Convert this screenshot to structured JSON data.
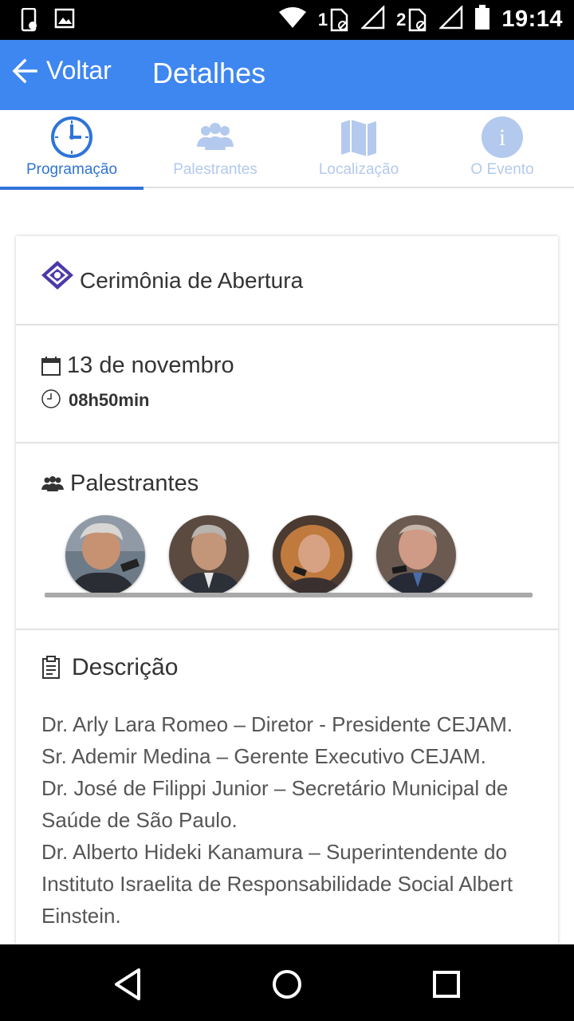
{
  "status_bar": {
    "time": "19:14",
    "sim1_label": "1",
    "sim2_label": "2",
    "icons": [
      "phone-settings-icon",
      "image-icon",
      "wifi-icon",
      "sim1-data-icon",
      "signal-icon",
      "sim2-data-icon",
      "signal-icon",
      "battery-icon"
    ]
  },
  "app_bar": {
    "back_label": "Voltar",
    "title": "Detalhes"
  },
  "tabs": [
    {
      "label": "Programação",
      "icon": "clock-icon",
      "active": true
    },
    {
      "label": "Palestrantes",
      "icon": "people-icon",
      "active": false
    },
    {
      "label": "Localização",
      "icon": "map-icon",
      "active": false
    },
    {
      "label": "O Evento",
      "icon": "info-icon",
      "active": false
    }
  ],
  "event": {
    "title": "Cerimônia de Abertura",
    "date": "13 de novembro",
    "time": "08h50min"
  },
  "speakers": {
    "title": "Palestrantes",
    "avatars": [
      "speaker-1",
      "speaker-2",
      "speaker-3",
      "speaker-4"
    ]
  },
  "description": {
    "title": "Descrição",
    "text": "Dr. Arly Lara Romeo – Diretor - Presidente CEJAM.\nSr. Ademir Medina – Gerente Executivo CEJAM.\nDr. José de Filippi Junior – Secretário Municipal de Saúde de São Paulo.\nDr. Alberto Hideki Kanamura – Superintendente do Instituto Israelita de Responsabilidade Social Albert Einstein."
  },
  "colors": {
    "accent": "#3e86f0",
    "tab_active": "#2f74d8",
    "tab_inactive": "#b3c9ee",
    "logo": "#4b3aa8"
  }
}
